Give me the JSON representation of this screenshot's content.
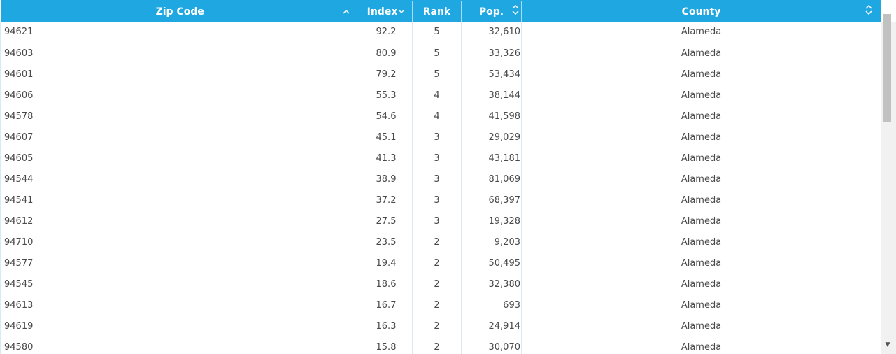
{
  "grid": {
    "columns": [
      {
        "label": "Zip Code",
        "sort_icon": "chevron-up-icon",
        "glyph": "^"
      },
      {
        "label": "Index",
        "sort_icon": "chevron-down-icon",
        "glyph": "⌄"
      },
      {
        "label": "Rank",
        "sort_icon": "",
        "glyph": ""
      },
      {
        "label": "Pop.",
        "sort_icon": "sort-updown-icon",
        "glyph": "⇳"
      },
      {
        "label": "County",
        "sort_icon": "sort-updown-icon",
        "glyph": "⇳"
      }
    ],
    "rows": [
      [
        "94621",
        "92.2",
        "5",
        "32,610",
        "Alameda"
      ],
      [
        "94603",
        "80.9",
        "5",
        "33,326",
        "Alameda"
      ],
      [
        "94601",
        "79.2",
        "5",
        "53,434",
        "Alameda"
      ],
      [
        "94606",
        "55.3",
        "4",
        "38,144",
        "Alameda"
      ],
      [
        "94578",
        "54.6",
        "4",
        "41,598",
        "Alameda"
      ],
      [
        "94607",
        "45.1",
        "3",
        "29,029",
        "Alameda"
      ],
      [
        "94605",
        "41.3",
        "3",
        "43,181",
        "Alameda"
      ],
      [
        "94544",
        "38.9",
        "3",
        "81,069",
        "Alameda"
      ],
      [
        "94541",
        "37.2",
        "3",
        "68,397",
        "Alameda"
      ],
      [
        "94612",
        "27.5",
        "3",
        "19,328",
        "Alameda"
      ],
      [
        "94710",
        "23.5",
        "2",
        "9,203",
        "Alameda"
      ],
      [
        "94577",
        "19.4",
        "2",
        "50,495",
        "Alameda"
      ],
      [
        "94545",
        "18.6",
        "2",
        "32,380",
        "Alameda"
      ],
      [
        "94613",
        "16.7",
        "2",
        "693",
        "Alameda"
      ],
      [
        "94619",
        "16.3",
        "2",
        "24,914",
        "Alameda"
      ],
      [
        "94580",
        "15.8",
        "2",
        "30,070",
        "Alameda"
      ]
    ]
  },
  "colors": {
    "header_bg": "#1ea7e0",
    "header_text": "#ffffff",
    "row_border": "#d6ecf5",
    "cell_text": "#4a4a4a"
  }
}
